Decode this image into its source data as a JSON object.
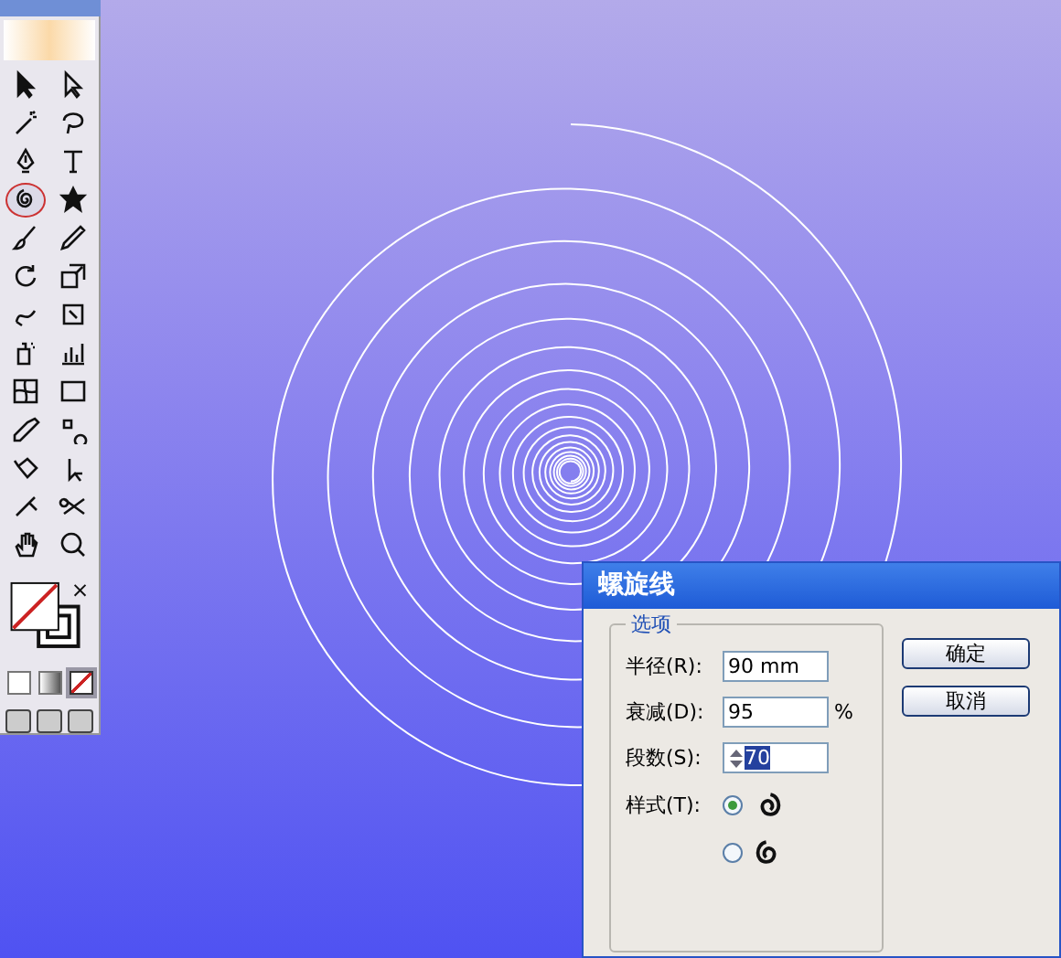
{
  "toolbox": {
    "tools": [
      {
        "kind": "selection",
        "selected": false
      },
      {
        "kind": "direct-selection",
        "selected": false
      },
      {
        "kind": "magic-wand",
        "selected": false
      },
      {
        "kind": "lasso",
        "selected": false
      },
      {
        "kind": "pen",
        "selected": false
      },
      {
        "kind": "type",
        "selected": false
      },
      {
        "kind": "spiral",
        "selected": true
      },
      {
        "kind": "star",
        "selected": false
      },
      {
        "kind": "brush",
        "selected": false
      },
      {
        "kind": "pencil",
        "selected": false
      },
      {
        "kind": "rotate",
        "selected": false
      },
      {
        "kind": "scale",
        "selected": false
      },
      {
        "kind": "warp",
        "selected": false
      },
      {
        "kind": "free-transform",
        "selected": false
      },
      {
        "kind": "sprayer",
        "selected": false
      },
      {
        "kind": "graph",
        "selected": false
      },
      {
        "kind": "mesh",
        "selected": false
      },
      {
        "kind": "gradient",
        "selected": false
      },
      {
        "kind": "eyedropper",
        "selected": false
      },
      {
        "kind": "blend",
        "selected": false
      },
      {
        "kind": "paint-bucket",
        "selected": false
      },
      {
        "kind": "live-select",
        "selected": false
      },
      {
        "kind": "slice",
        "selected": false
      },
      {
        "kind": "scissors",
        "selected": false
      },
      {
        "kind": "hand",
        "selected": false
      },
      {
        "kind": "zoom",
        "selected": false
      }
    ],
    "color_modes": [
      {
        "kind": "color",
        "selected": false
      },
      {
        "kind": "gradient",
        "selected": false
      },
      {
        "kind": "none",
        "selected": true
      }
    ]
  },
  "dialog": {
    "title": "螺旋线",
    "group": "选项",
    "fields": [
      {
        "label": "半径(R):",
        "value": "90 mm"
      },
      {
        "label": "衰减(D):",
        "value": "95",
        "unit": "%"
      },
      {
        "label": "段数(S):",
        "value": "70",
        "spinner": true
      }
    ],
    "style_label": "样式(T):",
    "styles": [
      {
        "kind": "clockwise",
        "selected": true
      },
      {
        "kind": "counter",
        "selected": false
      }
    ],
    "buttons": [
      "确定",
      "取消"
    ]
  }
}
